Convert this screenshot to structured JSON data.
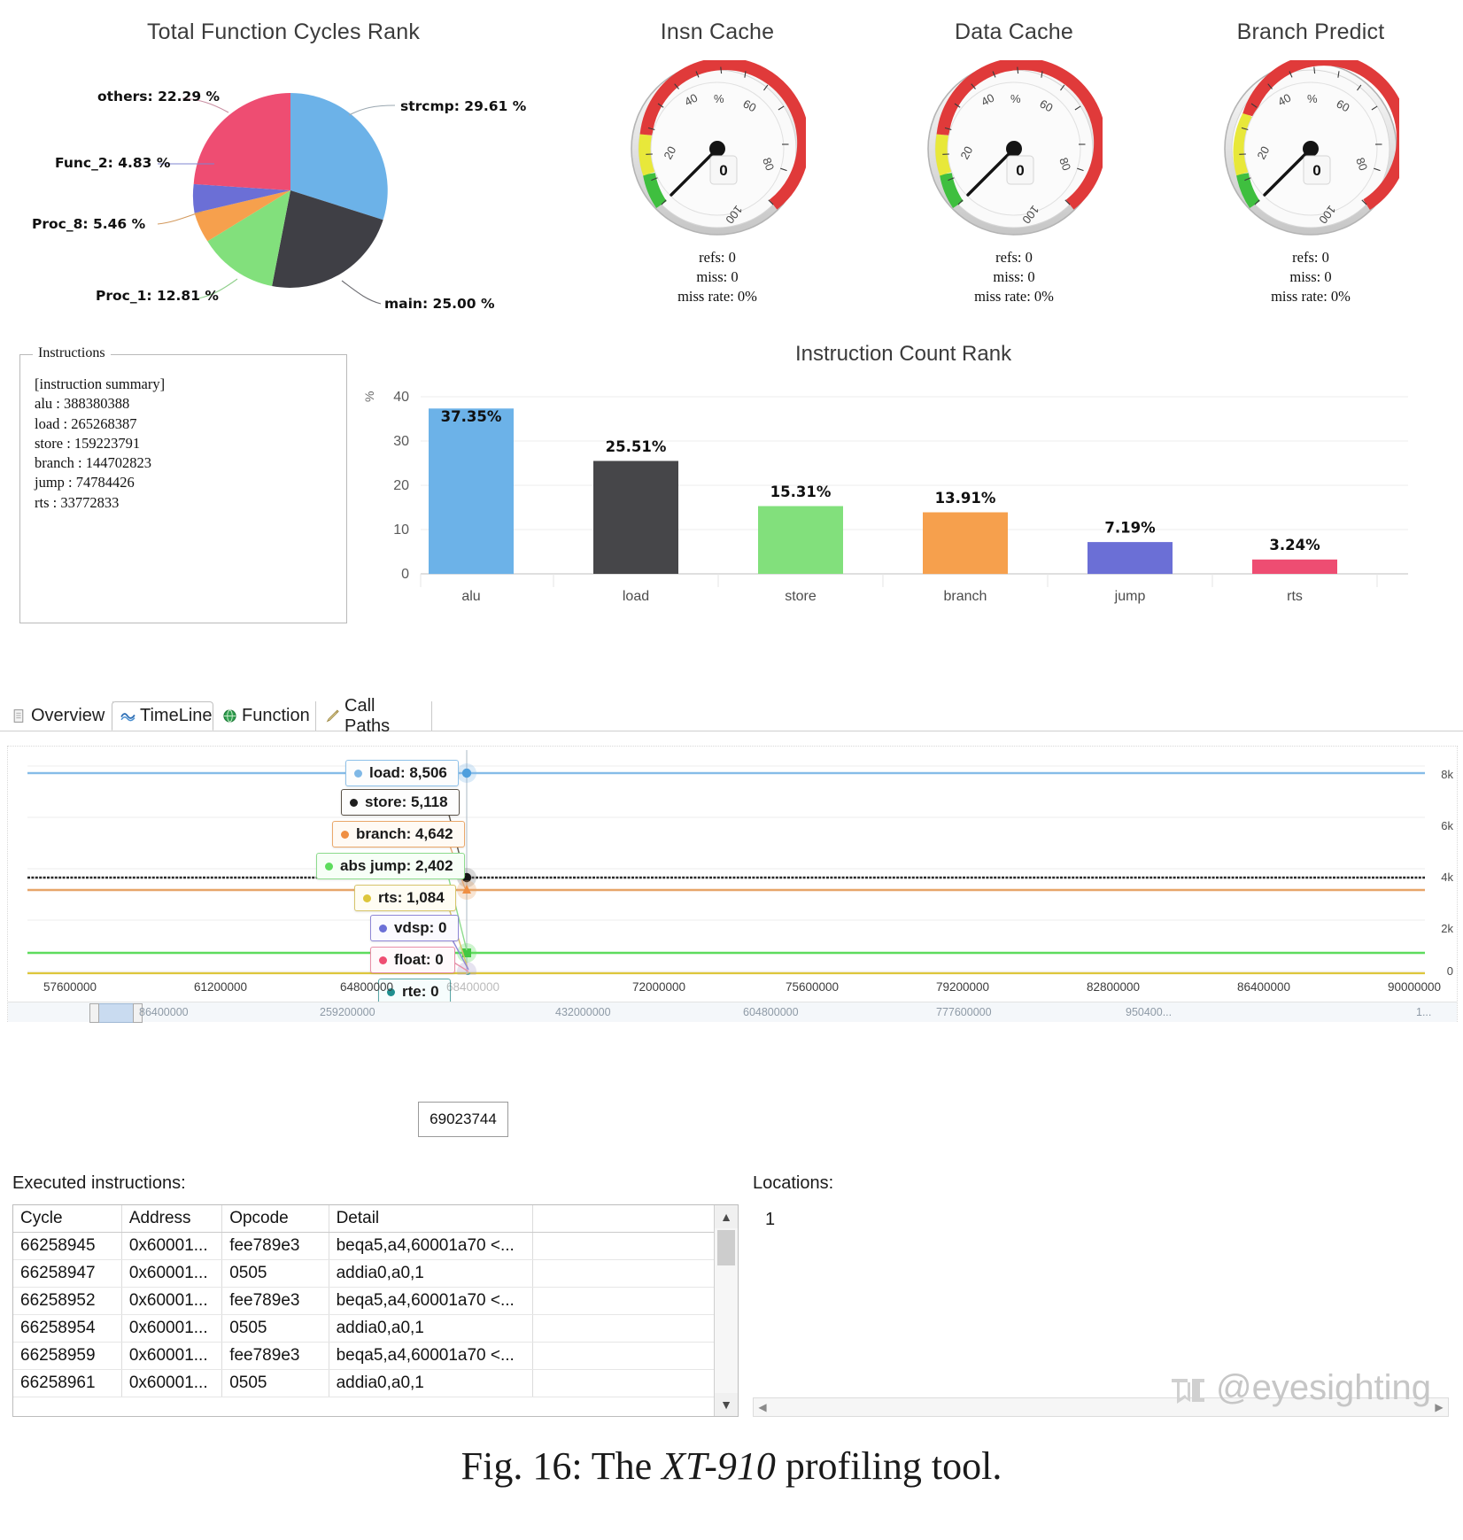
{
  "pie": {
    "title": "Total Function Cycles Rank",
    "labels": [
      {
        "text": "strcmp: 29.61 %",
        "color": "#6cb2e8"
      },
      {
        "text": "main: 25.00 %",
        "color": "#3f3f45"
      },
      {
        "text": "Proc_1: 12.81 %",
        "color": "#82e07c"
      },
      {
        "text": "Proc_8: 5.46 %",
        "color": "#f6a04d"
      },
      {
        "text": "Func_2: 4.83 %",
        "color": "#6b6fd6"
      },
      {
        "text": "others: 22.29 %",
        "color": "#ee4d72"
      }
    ]
  },
  "gauges": [
    {
      "title": "Insn Cache",
      "value": "0",
      "unit": "%",
      "ticks": [
        "20",
        "40",
        "60",
        "80",
        "100"
      ],
      "refs": "refs: 0",
      "miss": "miss: 0",
      "miss_rate": "miss rate: 0%"
    },
    {
      "title": "Data Cache",
      "value": "0",
      "unit": "%",
      "ticks": [
        "20",
        "40",
        "60",
        "80",
        "100"
      ],
      "refs": "refs: 0",
      "miss": "miss: 0",
      "miss_rate": "miss rate: 0%"
    },
    {
      "title": "Branch Predict",
      "value": "0",
      "unit": "%",
      "ticks": [
        "20",
        "40",
        "60",
        "80",
        "100"
      ],
      "refs": "refs: 0",
      "miss": "miss: 0",
      "miss_rate": "miss rate: 0%"
    }
  ],
  "instructions": {
    "legend": "Instructions",
    "lines": [
      "[instruction summary]",
      "alu : 388380388",
      "load : 265268387",
      "store : 159223791",
      "branch : 144702823",
      "jump : 74784426",
      "rts : 33772833"
    ]
  },
  "chart_data": [
    {
      "type": "pie",
      "title": "Total Function Cycles Rank",
      "categories": [
        "strcmp",
        "main",
        "Proc_1",
        "Proc_8",
        "Func_2",
        "others"
      ],
      "values": [
        29.61,
        25.0,
        12.81,
        5.46,
        4.83,
        22.29
      ],
      "unit": "%",
      "colors": [
        "#6cb2e8",
        "#3f3f45",
        "#82e07c",
        "#f6a04d",
        "#6b6fd6",
        "#ee4d72"
      ],
      "legend": "callout-labels"
    },
    {
      "type": "bar",
      "title": "Instruction Count Rank",
      "categories": [
        "alu",
        "load",
        "store",
        "branch",
        "jump",
        "rts"
      ],
      "values": [
        37.35,
        25.51,
        15.31,
        13.91,
        7.19,
        3.24
      ],
      "data_labels": [
        "37.35%",
        "25.51%",
        "15.31%",
        "13.91%",
        "7.19%",
        "3.24%"
      ],
      "colors": [
        "#6cb2e8",
        "#464649",
        "#82e07c",
        "#f6a04d",
        "#6b6fd6",
        "#ee4d72"
      ],
      "xlabel": "",
      "ylabel": "%",
      "ylim": [
        0,
        42
      ],
      "yticks": [
        0,
        10,
        20,
        30,
        40
      ],
      "grid": true
    },
    {
      "type": "line",
      "title": "TimeLine",
      "xlabel": "",
      "ylabel": "",
      "xticks": [
        "57600000",
        "61200000",
        "64800000",
        "68400000",
        "72000000",
        "75600000",
        "79200000",
        "82800000",
        "86400000",
        "90000000"
      ],
      "yticks": [
        "8k",
        "6k",
        "4k",
        "2k",
        "0"
      ],
      "ylim": [
        0,
        9000
      ],
      "cursor_x": "69023744",
      "series": [
        {
          "name": "load",
          "value": 8506,
          "label": "load: 8,506",
          "color": "#7fb8e6"
        },
        {
          "name": "store",
          "value": 5118,
          "label": "store: 5,118",
          "color": "#1e1e1e"
        },
        {
          "name": "branch",
          "value": 4642,
          "label": "branch: 4,642",
          "color": "#ef8f43"
        },
        {
          "name": "abs jump",
          "value": 2402,
          "label": "abs jump: 2,402",
          "color": "#5ddc5d"
        },
        {
          "name": "rts",
          "value": 1084,
          "label": "rts: 1,084",
          "color": "#ddc63b"
        },
        {
          "name": "vdsp",
          "value": 0,
          "label": "vdsp: 0",
          "color": "#6b6fd6"
        },
        {
          "name": "float",
          "value": 0,
          "label": "float: 0",
          "color": "#ee4d72"
        },
        {
          "name": "rte",
          "value": 0,
          "label": "rte: 0",
          "color": "#1f8f8f"
        }
      ]
    }
  ],
  "bar_chart": {
    "title": "Instruction Count Rank",
    "ylabel": "%",
    "yticks": [
      "40",
      "30",
      "20",
      "10",
      "0"
    ],
    "bars": [
      {
        "label": "alu",
        "value": 37.35,
        "data_label": "37.35%",
        "color": "#6cb2e8"
      },
      {
        "label": "load",
        "value": 25.51,
        "data_label": "25.51%",
        "color": "#464649"
      },
      {
        "label": "store",
        "value": 15.31,
        "data_label": "15.31%",
        "color": "#82e07c"
      },
      {
        "label": "branch",
        "value": 13.91,
        "data_label": "13.91%",
        "color": "#f6a04d"
      },
      {
        "label": "jump",
        "value": 7.19,
        "data_label": "7.19%",
        "color": "#6b6fd6"
      },
      {
        "label": "rts",
        "value": 3.24,
        "data_label": "3.24%",
        "color": "#ee4d72"
      }
    ]
  },
  "tabs": [
    {
      "label": "Overview",
      "icon": "document-icon",
      "active": false
    },
    {
      "label": "TimeLine",
      "icon": "wave-icon",
      "active": true
    },
    {
      "label": "Function",
      "icon": "globe-icon",
      "active": false
    },
    {
      "label": "Call Paths",
      "icon": "pencil-icon",
      "active": false
    }
  ],
  "timeline": {
    "tooltips": [
      {
        "label": "load: 8,506",
        "color": "#7fb8e6",
        "border": "#8fc2ea"
      },
      {
        "label": "store: 5,118",
        "color": "#1e1e1e",
        "border": "#4a4038"
      },
      {
        "label": "branch: 4,642",
        "color": "#ef8f43",
        "border": "#eaa86a"
      },
      {
        "label": "abs jump: 2,402",
        "color": "#5ddc5d",
        "border": "#8ddc8d"
      },
      {
        "label": "rts: 1,084",
        "color": "#ddc63b",
        "border": "#d7c46a"
      },
      {
        "label": "vdsp: 0",
        "color": "#6b6fd6",
        "border": "#8f87d6"
      },
      {
        "label": "float: 0",
        "color": "#ee4d72",
        "border": "#e88fa8"
      },
      {
        "label": "rte: 0",
        "color": "#1f8f8f",
        "border": "#5aa8a8"
      }
    ],
    "yticks": [
      "8k",
      "6k",
      "4k",
      "2k",
      "0"
    ],
    "xticks": [
      "57600000",
      "61200000",
      "64800000",
      "68400000",
      "72000000",
      "75600000",
      "79200000",
      "82800000",
      "86400000",
      "90000000"
    ],
    "cursor_value": "69023744",
    "scroll_ticks": [
      "86400000",
      "259200000",
      "432000000",
      "604800000",
      "777600000",
      "950400..."
    ],
    "scroll_tail": "1..."
  },
  "bottom": {
    "executed_label": "Executed instructions:",
    "locations_label": "Locations:",
    "location_value": "1",
    "columns": [
      "Cycle",
      "Address",
      "Opcode",
      "Detail",
      ""
    ],
    "rows": [
      [
        "66258945",
        "0x60001...",
        "fee789e3",
        "beqa5,a4,60001a70 <...",
        ""
      ],
      [
        "66258947",
        "0x60001...",
        "0505",
        "addia0,a0,1",
        ""
      ],
      [
        "66258952",
        "0x60001...",
        "fee789e3",
        "beqa5,a4,60001a70 <...",
        ""
      ],
      [
        "66258954",
        "0x60001...",
        "0505",
        "addia0,a0,1",
        ""
      ],
      [
        "66258959",
        "0x60001...",
        "fee789e3",
        "beqa5,a4,60001a70 <...",
        ""
      ],
      [
        "66258961",
        "0x60001...",
        "0505",
        "addia0,a0,1",
        ""
      ]
    ]
  },
  "caption": {
    "prefix": "Fig. 16:  The ",
    "italic": "XT-910",
    "suffix": " profiling tool."
  },
  "watermark": {
    "text": "@eyesighting"
  }
}
